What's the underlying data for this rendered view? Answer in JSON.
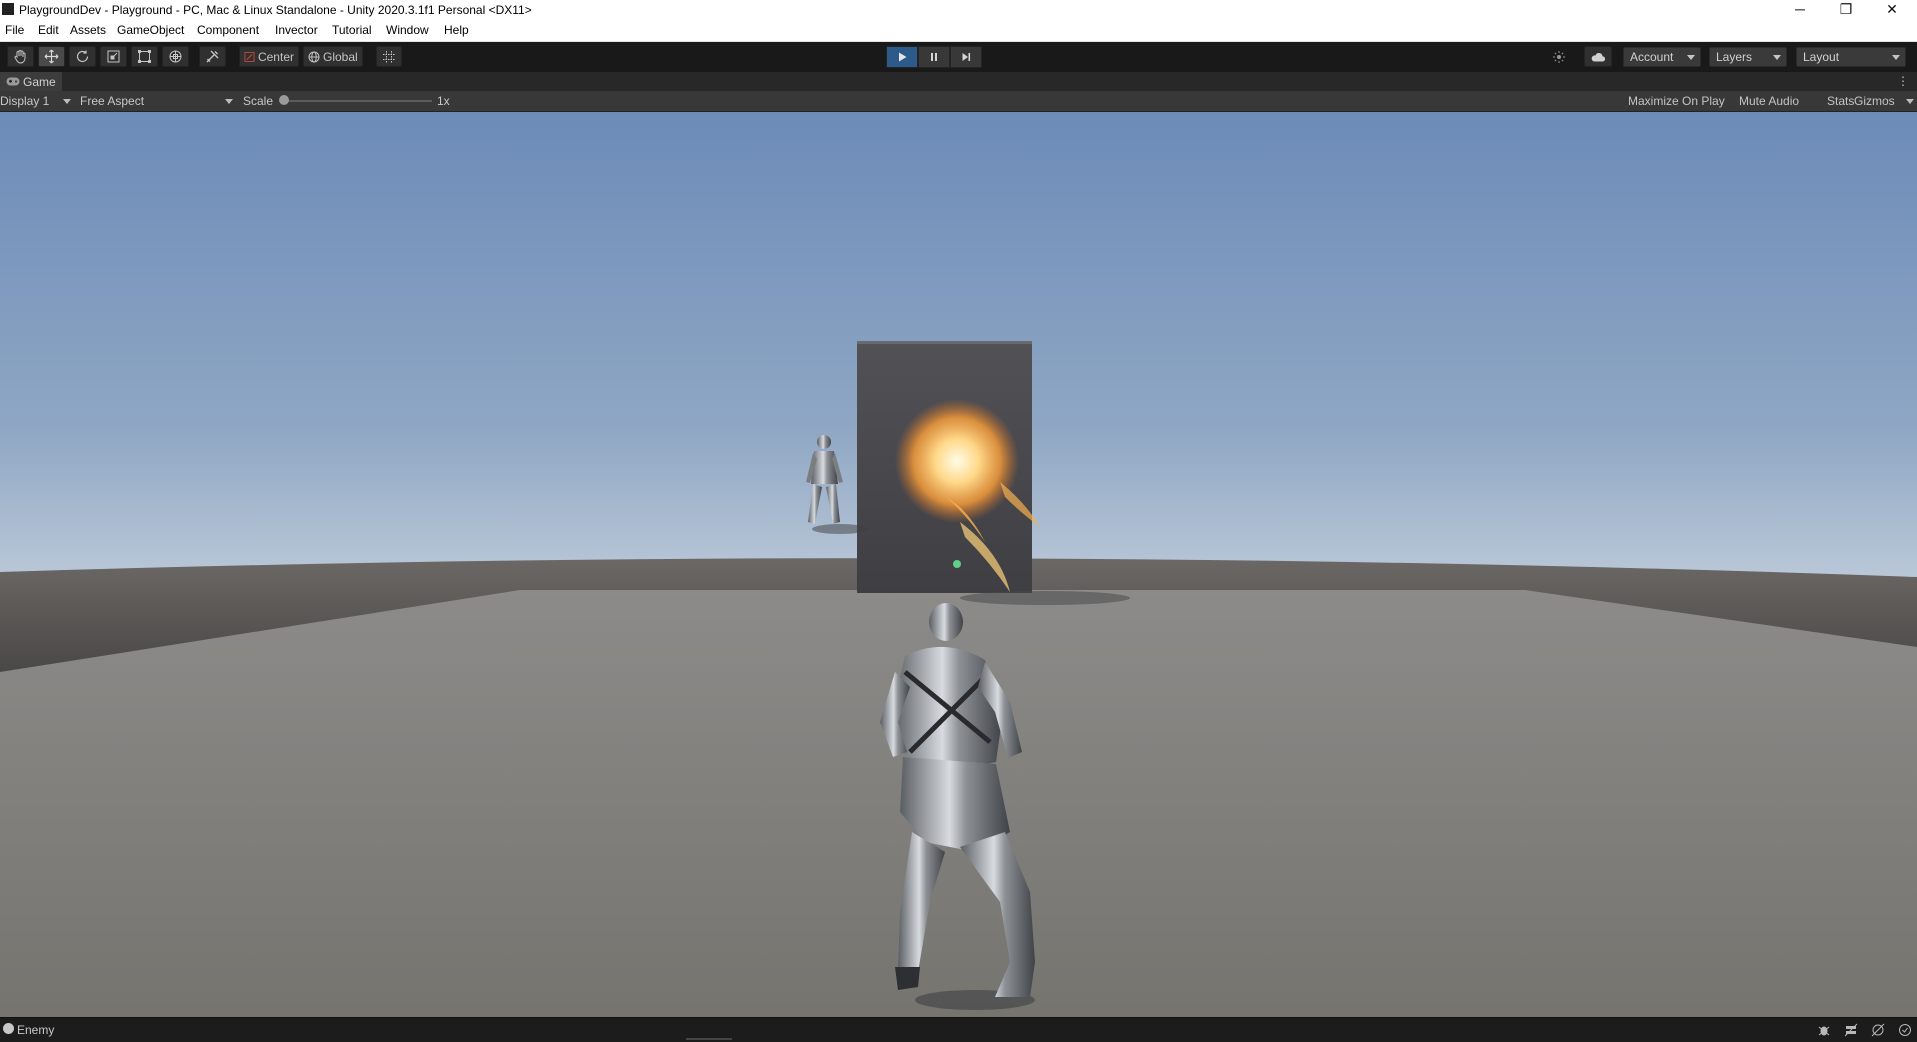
{
  "window": {
    "title": "PlaygroundDev - Playground - PC, Mac & Linux Standalone - Unity 2020.3.1f1 Personal <DX11>",
    "controls": {
      "minimize": "─",
      "maximize": "❐",
      "close": "✕"
    }
  },
  "menubar": {
    "items": [
      "File",
      "Edit",
      "Assets",
      "GameObject",
      "Component",
      "Invector",
      "Tutorial",
      "Window",
      "Help"
    ]
  },
  "toolbar": {
    "tools": [
      "hand-icon",
      "move-icon",
      "rotate-icon",
      "scale-icon",
      "rect-icon",
      "transform-icon",
      "custom-tool-icon"
    ],
    "active_tool": "move-icon",
    "pivot_mode": "Center",
    "pivot_rotation": "Global",
    "play_state": "playing",
    "account_label": "Account",
    "layers_label": "Layers",
    "layout_label": "Layout"
  },
  "game_view": {
    "tab_label": "Game",
    "display": "Display 1",
    "aspect": "Free Aspect",
    "scale_label": "Scale",
    "scale_value": "1x",
    "scale_level": 0,
    "maximize_on_play": "Maximize On Play",
    "mute_audio": "Mute Audio",
    "stats": "Stats",
    "gizmos": "Gizmos"
  },
  "status": {
    "message": "Enemy"
  },
  "colors": {
    "play_active": "#2b5a8b",
    "sky_top": "#6d8db9",
    "horizon": "#dfe5ea",
    "ground": "#7c7b79"
  }
}
